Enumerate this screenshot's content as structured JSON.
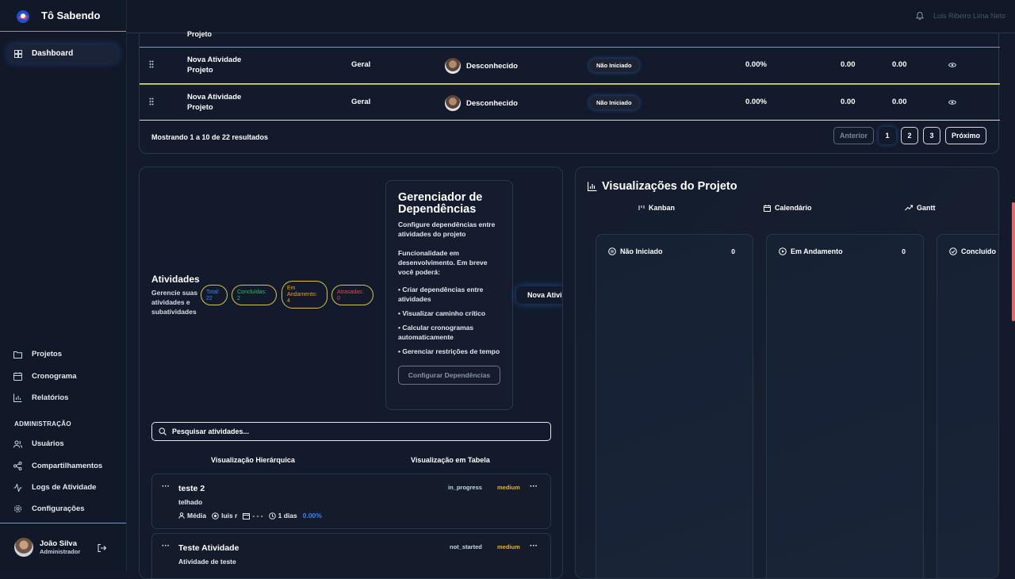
{
  "app": {
    "title": "Tô Sabendo"
  },
  "sidebar": {
    "dashboard": "Dashboard",
    "items": [
      {
        "label": "Projetos",
        "icon": "folder-icon"
      },
      {
        "label": "Cronograma",
        "icon": "calendar-icon"
      },
      {
        "label": "Relatórios",
        "icon": "bar-chart-icon"
      }
    ],
    "admin_heading": "ADMINISTRAÇÃO",
    "admin_items": [
      {
        "label": "Usuários",
        "icon": "users-icon"
      },
      {
        "label": "Compartilhamentos",
        "icon": "share-icon"
      },
      {
        "label": "Logs de Atividade",
        "icon": "activity-icon"
      },
      {
        "label": "Configurações",
        "icon": "gear-icon"
      }
    ],
    "user": {
      "name": "João Silva",
      "role": "Administrador"
    }
  },
  "topbar": {
    "user_name": "Luis Ribeiro Lima Neto"
  },
  "table": {
    "partial_row_text": "Projeto",
    "rows": [
      {
        "name_line1": "Nova Atividade",
        "name_line2": "Projeto",
        "category": "Geral",
        "assignee": "Desconhecido",
        "status": "Não Iniciado",
        "progress": "0.00%",
        "val1": "0.00",
        "val2": "0.00"
      },
      {
        "name_line1": "Nova Atividade",
        "name_line2": "Projeto",
        "category": "Geral",
        "assignee": "Desconhecido",
        "status": "Não Iniciado",
        "progress": "0.00%",
        "val1": "0.00",
        "val2": "0.00"
      }
    ],
    "showing": "Mostrando 1 a 10 de 22 resultados",
    "pagination": {
      "prev": "Anterior",
      "pages": [
        "1",
        "2",
        "3"
      ],
      "next": "Próximo"
    }
  },
  "activities": {
    "title": "Atividades",
    "description": "Gerencie suas atividades e subatividades",
    "stats": [
      {
        "label": "Total:",
        "value": "22",
        "color": "#3b82f6"
      },
      {
        "label": "Concluídas:",
        "value": "2",
        "color": "#22c55e"
      },
      {
        "label": "Em Andamento:",
        "value": "4",
        "color": "#f59e0b"
      },
      {
        "label": "Atrasadas:",
        "value": "0",
        "color": "#ef4444"
      }
    ],
    "new_button": "Nova Atividade",
    "search_placeholder": "Pesquisar atividades...",
    "view_tabs": [
      "Visualização Hierárquica",
      "Visualização em Tabela"
    ],
    "tasks": [
      {
        "name": "teste 2",
        "description": "telhado",
        "status": "in_progress",
        "priority": "medium",
        "meta_priority": "Média",
        "meta_user": "luis r",
        "meta_date": "- - -",
        "meta_duration": "1 dias",
        "meta_progress": "0.00%"
      },
      {
        "name": "Teste Atividade",
        "description": "Atividade de teste",
        "status": "not_started",
        "priority": "medium"
      }
    ]
  },
  "dependencies": {
    "title": "Gerenciador de Dependências",
    "subtitle": "Configure dependências entre atividades do projeto",
    "notice": "Funcionalidade em desenvolvimento. Em breve você poderá:",
    "bullets": [
      "• Criar dependências entre atividades",
      "• Visualizar caminho crítico",
      "• Calcular cronogramas automaticamente",
      "• Gerenciar restrições de tempo"
    ],
    "button": "Configurar Dependências"
  },
  "visualizations": {
    "title": "Visualizações do Projeto",
    "tabs": [
      "Kanban",
      "Calendário",
      "Gantt"
    ],
    "columns": [
      {
        "label": "Não Iniciado",
        "count": "0"
      },
      {
        "label": "Em Andamento",
        "count": "0"
      },
      {
        "label": "Concluído",
        "count": ""
      }
    ]
  }
}
